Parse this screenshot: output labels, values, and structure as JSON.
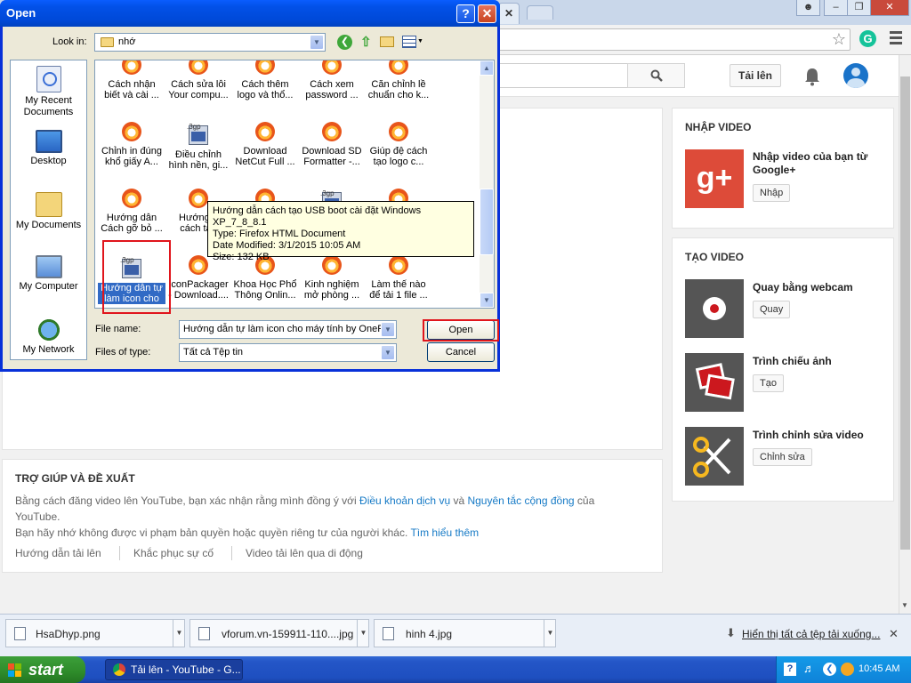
{
  "dialog": {
    "title": "Open",
    "look_in_label": "Look in:",
    "look_in_value": "nhớ",
    "places": [
      {
        "label": "My Recent Documents"
      },
      {
        "label": "Desktop"
      },
      {
        "label": "My Documents"
      },
      {
        "label": "My Computer"
      },
      {
        "label": "My Network"
      }
    ],
    "files": [
      {
        "line1": "Cách nhận",
        "line2": "biết và cài ...",
        "icon": "firefox"
      },
      {
        "line1": "Cách sửa lỗi",
        "line2": "Your compu...",
        "icon": "firefox"
      },
      {
        "line1": "Cách thêm",
        "line2": "logo và thổ...",
        "icon": "firefox"
      },
      {
        "line1": "Cách xem",
        "line2": "password ...",
        "icon": "firefox"
      },
      {
        "line1": "Căn chỉnh lề",
        "line2": "chuẩn cho k...",
        "icon": "firefox"
      },
      {
        "line1": "Chỉnh in đúng",
        "line2": "khổ giấy A...",
        "icon": "firefox"
      },
      {
        "line1": "Điều chỉnh",
        "line2": "hình nền, gi...",
        "icon": "3gp"
      },
      {
        "line1": "Download",
        "line2": "NetCut Full ...",
        "icon": "firefox"
      },
      {
        "line1": "Download SD",
        "line2": "Formatter -...",
        "icon": "firefox"
      },
      {
        "line1": "Giúp đệ cách",
        "line2": "tạo logo c...",
        "icon": "firefox"
      },
      {
        "line1": "Hướng dẫn",
        "line2": "Cách gỡ bỏ ...",
        "icon": "firefox"
      },
      {
        "line1": "Hướng d",
        "line2": "cách tạo",
        "icon": "firefox"
      },
      {
        "line1": "",
        "line2": "",
        "icon": "firefox"
      },
      {
        "line1": "",
        "line2": "",
        "icon": "3gp"
      },
      {
        "line1": "",
        "line2": "",
        "icon": "firefox"
      },
      {
        "line1": "Hướng dẫn tự",
        "line2": "làm icon cho",
        "icon": "3gp"
      },
      {
        "line1": "IconPackager",
        "line2": "- Download....",
        "icon": "firefox"
      },
      {
        "line1": "Khoa Học Phổ",
        "line2": "Thông Onlin...",
        "icon": "firefox"
      },
      {
        "line1": "Kinh nghiệm",
        "line2": "mở phòng ...",
        "icon": "firefox"
      },
      {
        "line1": "Làm thế nào",
        "line2": "để tải 1 file ...",
        "icon": "firefox"
      }
    ],
    "tooltip": {
      "line1": "Hướng dẫn cách tạo USB boot cài đặt Windows XP_7_8_8.1",
      "line2": "Type: Firefox HTML Document",
      "line3": "Date Modified: 3/1/2015 10:05 AM",
      "line4": "Size: 132 KB"
    },
    "file_name_label": "File name:",
    "file_name_value": "Hướng dẫn tự làm icon cho máy tính by OnePie",
    "file_type_label": "Files of type:",
    "file_type_value": "Tất cả Tệp tin",
    "open_label": "Open",
    "cancel_label": "Cancel",
    "help_glyph": "?",
    "close_glyph": "✕"
  },
  "youtube": {
    "upload_label": "Tải lên",
    "import_section": {
      "title": "NHẬP VIDEO",
      "item_title": "Nhập video của bạn từ Google+",
      "button": "Nhập"
    },
    "create_section": {
      "title": "TẠO VIDEO",
      "items": [
        {
          "title": "Quay bằng webcam",
          "button": "Quay",
          "icon": "webcam-icon"
        },
        {
          "title": "Trình chiếu ảnh",
          "button": "Tạo",
          "icon": "slideshow-icon"
        },
        {
          "title": "Trình chỉnh sửa video",
          "button": "Chỉnh sửa",
          "icon": "scissors-icon"
        }
      ]
    },
    "help": {
      "title": "TRỢ GIÚP VÀ ĐỀ XUẤT",
      "p1_a": "Bằng cách đăng video lên YouTube, bạn xác nhận rằng mình đồng ý với ",
      "p1_link1": "Điều khoản dịch vụ",
      "p1_b": " và ",
      "p1_link2": "Nguyên tắc cộng đồng",
      "p1_c": " của",
      "p1_d": "YouTube.",
      "p2_a": "Bạn hãy nhớ không được vi phạm bản quyền hoặc quyền riêng tư của người khác. ",
      "p2_link": "Tìm hiểu thêm",
      "links": [
        "Hướng dẫn tải lên",
        "Khắc phục sự cố",
        "Video tải lên qua di động"
      ]
    }
  },
  "downloads": {
    "items": [
      "HsaDhyp.png",
      "vforum.vn-159911-110....jpg",
      "hinh 4.jpg"
    ],
    "show_all": "Hiển thị tất cả tệp tải xuống...",
    "close_glyph": "✕"
  },
  "taskbar": {
    "start_label": "start",
    "task_label": "Tải lên - YouTube - G...",
    "clock": "10:45 AM"
  },
  "colors": {
    "xp_blue": "#0831d9",
    "yt_link": "#167ac6",
    "highlight_red": "#e0151c",
    "google_plus_red": "#dd4b39"
  }
}
